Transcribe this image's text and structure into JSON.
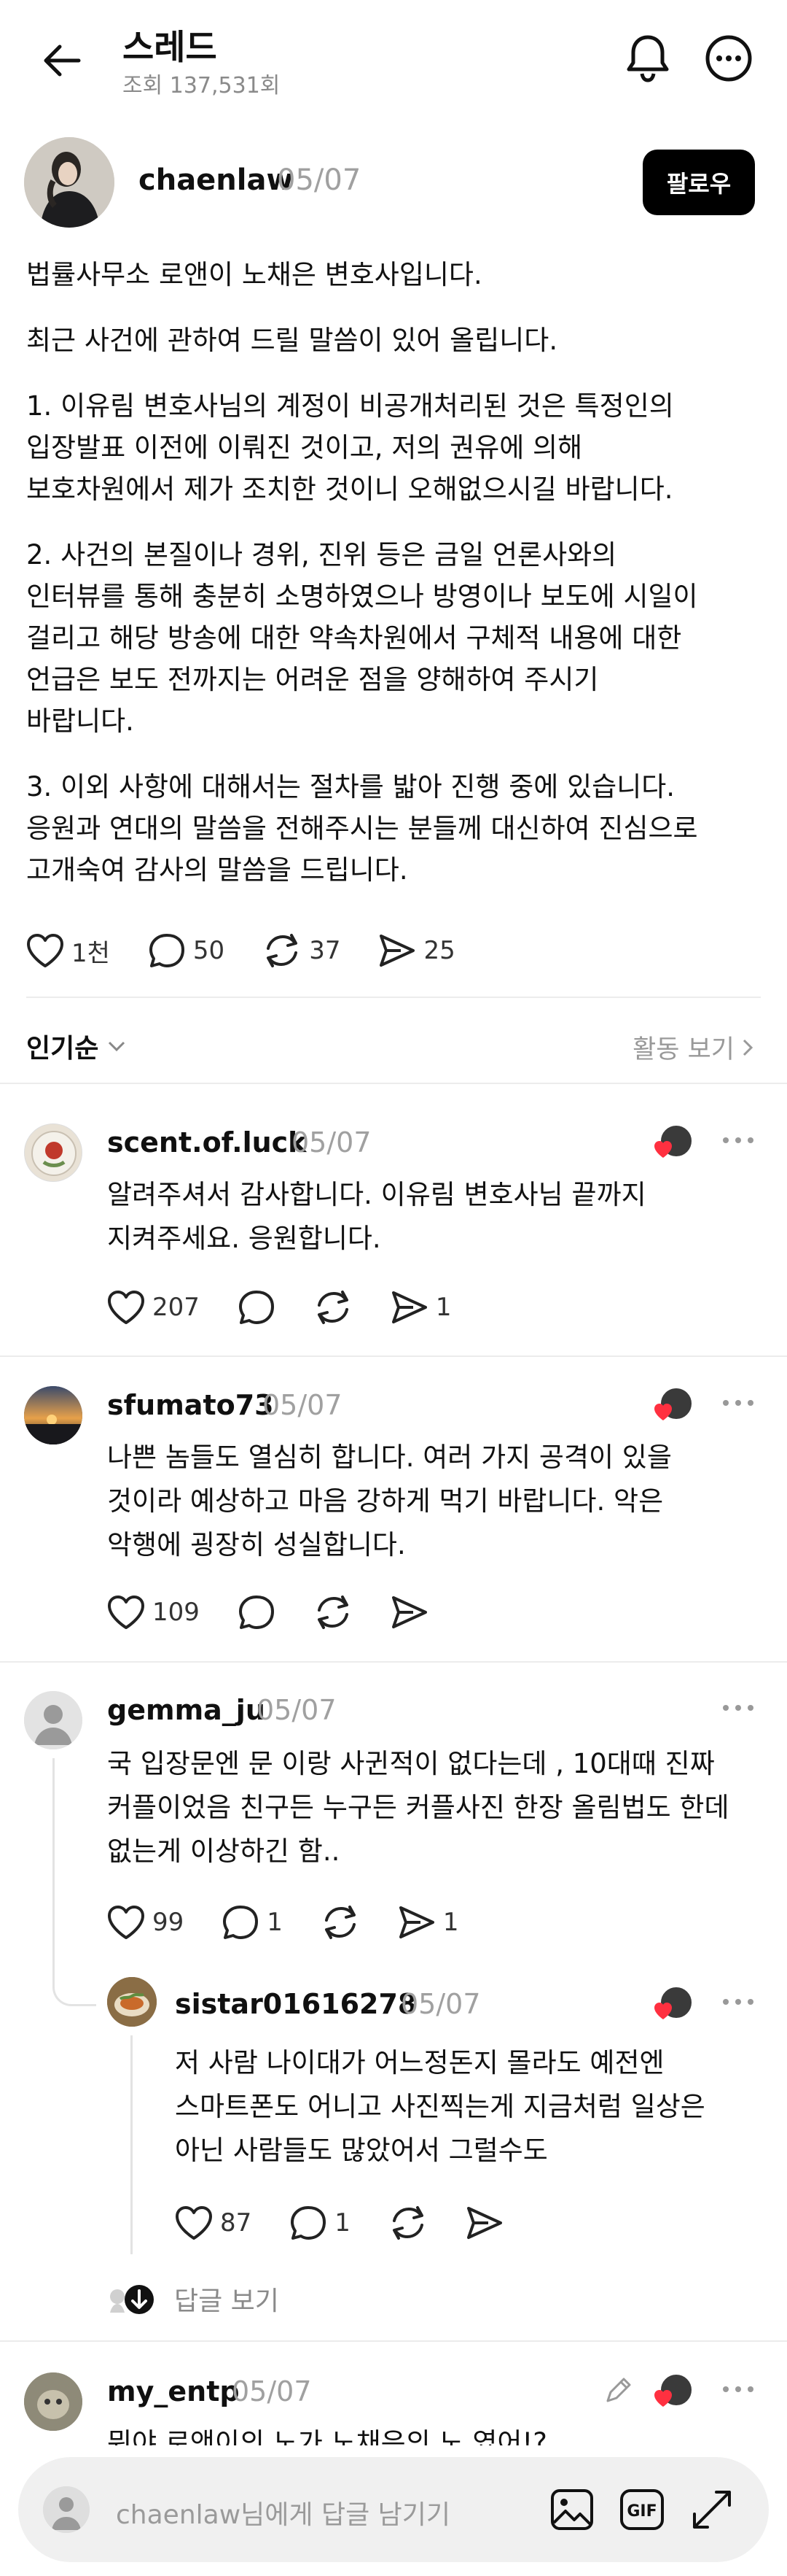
{
  "header": {
    "title": "스레드",
    "views": "조회 137,531회"
  },
  "post": {
    "username": "chaenlaw",
    "date": "05/07",
    "follow_label": "팔로우",
    "lines": [
      "법률사무소 로앤이 노채은 변호사입니다.",
      "최근 사건에 관하여 드릴 말씀이 있어 올립니다.",
      "1. 이유림 변호사님의 계정이 비공개처리된 것은 특정인의",
      "입장발표 이전에 이뤄진 것이고, 저의 권유에 의해",
      "보호차원에서 제가 조치한 것이니 오해없으시길 바랍니다.",
      "2. 사건의 본질이나 경위, 진위 등은 금일 언론사와의",
      "인터뷰를 통해 충분히 소명하였으나 방영이나 보도에 시일이",
      "걸리고 해당 방송에 대한 약속차원에서 구체적 내용에 대한",
      "언급은 보도 전까지는 어려운 점을 양해하여 주시기",
      "바랍니다.",
      "3. 이외 사항에 대해서는 절차를 밟아 진행 중에 있습니다.",
      "응원과 연대의 말씀을 전해주시는 분들께 대신하여 진심으로",
      "고개숙여 감사의 말씀을 드립니다."
    ],
    "likes": "1천",
    "replies": "50",
    "reposts": "37",
    "shares": "25"
  },
  "sort": {
    "label": "인기순",
    "activity_label": "활동 보기"
  },
  "comments": [
    {
      "username": "scent.of.luck",
      "date": "05/07",
      "lines": [
        "알려주셔서 감사합니다. 이유림 변호사님 끝까지",
        "지켜주세요. 응원합니다."
      ],
      "likes": "207",
      "replies": "",
      "reposts": "",
      "shares": "1"
    },
    {
      "username": "sfumato73",
      "date": "05/07",
      "lines": [
        "나쁜 놈들도 열심히 합니다. 여러 가지 공격이 있을",
        "것이라 예상하고 마음 강하게 먹기 바랍니다. 악은",
        "악행에 굉장히 성실합니다."
      ],
      "likes": "109",
      "replies": "",
      "reposts": "",
      "shares": ""
    },
    {
      "username": "gemma_ju",
      "date": "05/07",
      "lines": [
        "국 입장문엔 문 이랑 사귄적이 없다는데 , 10대때 진짜",
        "커플이었음 친구든 누구든 커플사진 한장 올림법도 한데",
        "없는게 이상하긴 함.."
      ],
      "likes": "99",
      "replies": "1",
      "reposts": "",
      "shares": "1"
    },
    {
      "username": "sistar01616278",
      "date": "05/07",
      "lines": [
        "저 사람 나이대가 어느정돈지 몰라도 예전엔",
        "스마트폰도 어니고 사진찍는게 지금처럼 일상은",
        "아닌 사람들도 많았어서 그럴수도"
      ],
      "likes": "87",
      "replies": "1",
      "reposts": "",
      "shares": ""
    },
    {
      "username": "my_entp",
      "date": "05/07",
      "lines": [
        "뭐야 로앤이의 노가 노채은의 노 였어!?"
      ]
    }
  ],
  "view_replies_label": "답글 보기",
  "reply_bar": {
    "placeholder": "chaenlaw님에게 답글 남기기"
  },
  "colors": {
    "heart_red": "#ff3040",
    "button_black": "#000000",
    "muted_gray": "#999999"
  }
}
